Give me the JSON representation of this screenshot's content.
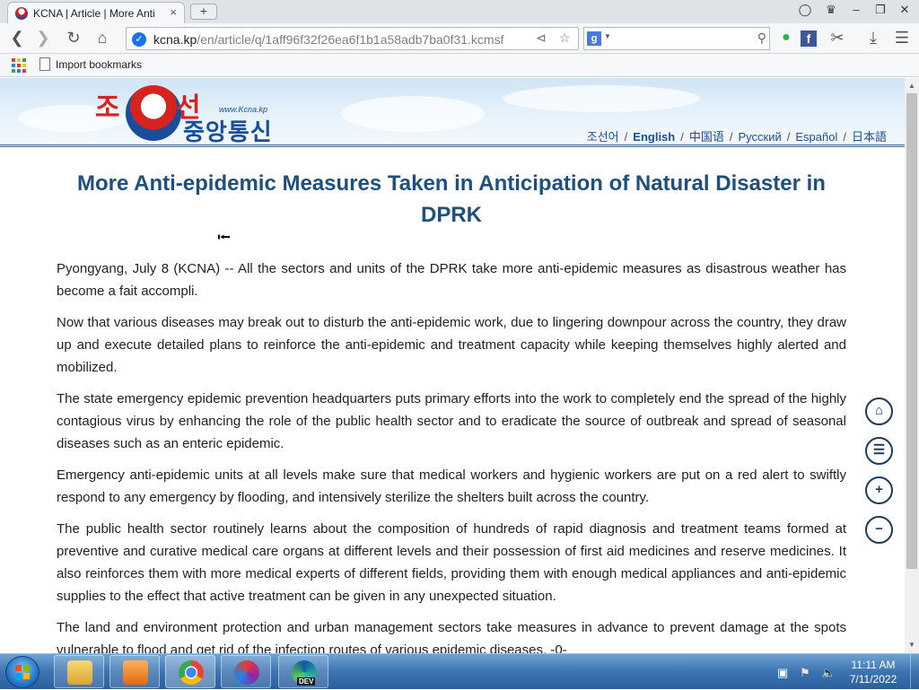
{
  "browser": {
    "tab_title": "KCNA | Article | More Anti",
    "tab_close": "×",
    "new_tab": "+",
    "url_host": "kcna.kp",
    "url_path": "/en/article/q/1aff96f32f26ea6f1b1a58adb7ba0f31.kcmsf",
    "search_engine_logo": "g",
    "search_placeholder": "",
    "bookmarks_label": "Import bookmarks"
  },
  "site": {
    "logo_line1_a": "조",
    "logo_line1_b": "선",
    "logo_url": "www.Kcna.kp",
    "logo_line2": "중앙통신",
    "languages": [
      "조선어",
      "English",
      "中国语",
      "Русский",
      "Español",
      "日本語"
    ],
    "active_language": "English",
    "separator": "/"
  },
  "article": {
    "headline": "More Anti-epidemic Measures Taken in Anticipation of Natural Disaster in DPRK",
    "paragraphs": [
      "Pyongyang, July 8 (KCNA) -- All the sectors and units of the DPRK take more anti-epidemic measures as disastrous weather has become a fait accompli.",
      "Now that various diseases may break out to disturb the anti-epidemic work, due to lingering downpour across the country, they draw up and execute detailed plans to reinforce the anti-epidemic and treatment capacity while keeping themselves highly alerted and mobilized.",
      "The state emergency epidemic prevention headquarters puts primary efforts into the work to completely end the spread of the highly contagious virus by enhancing the role of the public health sector and to eradicate the source of outbreak and spread of seasonal diseases such as an enteric epidemic.",
      "Emergency anti-epidemic units at all levels make sure that medical workers and hygienic workers are put on a red alert to swiftly respond to any emergency by flooding, and intensively sterilize the shelters built across the country.",
      "The public health sector routinely learns about the composition of hundreds of rapid diagnosis and treatment teams formed at preventive and curative medical care organs at different levels and their possession of first aid medicines and reserve medicines. It also reinforces them with more medical experts of different fields, providing them with enough medical appliances and anti-epidemic supplies to the effect that active treatment can be given in any unexpected situation.",
      "The land and environment protection and urban management sectors take measures in advance to prevent damage at the spots vulnerable to flood and get rid of the infection routes of various epidemic diseases. -0-"
    ]
  },
  "side_tools": [
    "home-icon",
    "list-icon",
    "zoom-in-icon",
    "zoom-out-icon"
  ],
  "taskbar": {
    "clock_time": "11:11 AM",
    "clock_date": "7/11/2022",
    "edge_badge": "DEV"
  },
  "colors": {
    "headline": "#1d4f7f",
    "logo_red": "#d6231d",
    "logo_blue": "#1a4e9a",
    "taskbar": "#3d74b0"
  }
}
